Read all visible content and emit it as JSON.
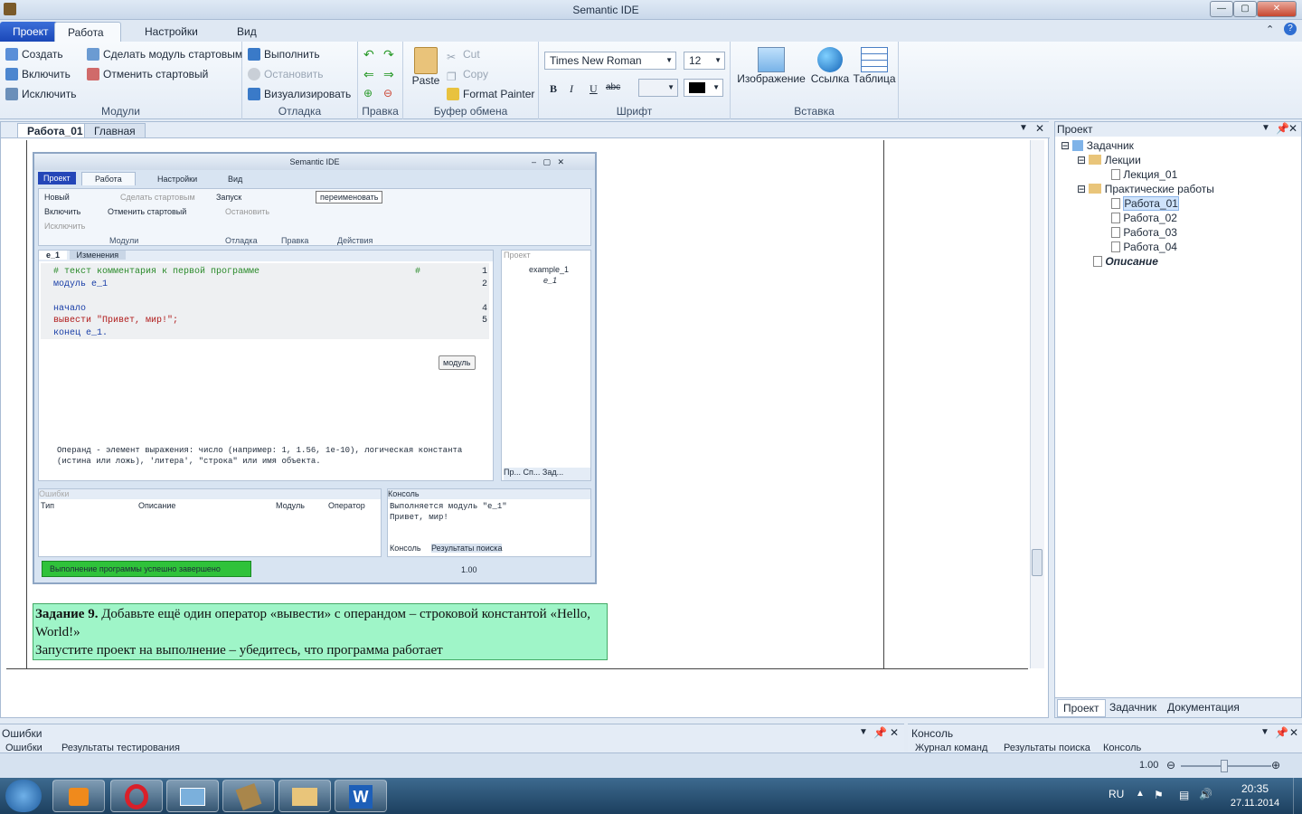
{
  "window": {
    "title": "Semantic IDE",
    "controls": [
      "minimize-icon",
      "maximize-icon",
      "close-icon"
    ]
  },
  "ribbon_tabs": [
    "Проект",
    "Работа",
    "Настройки",
    "Вид"
  ],
  "ribbon": {
    "modules": {
      "label": "Модули",
      "create": "Создать",
      "include": "Включить",
      "exclude": "Исключить",
      "make_start": "Сделать модуль стартовым",
      "cancel_start": "Отменить стартовый"
    },
    "debug": {
      "label": "Отладка",
      "run": "Выполнить",
      "stop": "Остановить",
      "visualize": "Визуализировать"
    },
    "edit": {
      "label": "Правка"
    },
    "clipboard": {
      "label": "Буфер обмена",
      "paste": "Paste",
      "cut": "Cut",
      "copy": "Copy",
      "format_painter": "Format Painter"
    },
    "font": {
      "label": "Шрифт",
      "family": "Times New Roman",
      "size": "12",
      "bold": "B",
      "italic": "I",
      "underline": "U",
      "strike": "abc"
    },
    "insert": {
      "label": "Вставка",
      "image": "Изображение",
      "link": "Ссылка",
      "table": "Таблица"
    }
  },
  "doc_tabs": [
    "Работа_01",
    "Главная"
  ],
  "inner": {
    "title": "Semantic IDE",
    "tabs": [
      "Проект",
      "Работа",
      "Настройки",
      "Вид"
    ],
    "modules": {
      "label": "Модули",
      "new": "Новый",
      "include": "Включить",
      "exclude": "Исключить",
      "make_start": "Сделать стартовым",
      "cancel_start": "Отменить стартовый"
    },
    "debug": {
      "label": "Отладка",
      "run": "Запуск",
      "stop": "Остановить"
    },
    "edit_label": "Правка",
    "actions": {
      "label": "Действия",
      "rename": "переименовать"
    },
    "editor_tabs": [
      "e_1",
      "Изменения"
    ],
    "code": [
      {
        "n": "1",
        "text": "# текст комментария к первой программе",
        "tail": "#"
      },
      {
        "n": "2",
        "text": "модуль e_1"
      },
      {
        "n": "",
        "text": ""
      },
      {
        "n": "4",
        "text": "начало"
      },
      {
        "n": "5",
        "text": "    вывести \"Привет, мир!\";"
      },
      {
        "n": "",
        "text": "конец e_1."
      }
    ],
    "tooltip": "модуль",
    "hint1": "Операнд - элемент выражения: число (например: 1, 1.56, 1e-10), логическая константа",
    "hint2": "(истина или  ложь), 'литера', \"строка\" или имя объекта.",
    "project": {
      "title": "Проект",
      "root": "example_1",
      "child": "e_1",
      "tabs": [
        "Пр...",
        "Сп...",
        "Зад..."
      ]
    },
    "errors": {
      "title": "Ошибки",
      "cols": [
        "Тип",
        "Описание",
        "Модуль",
        "Оператор"
      ]
    },
    "console": {
      "title": "Консоль",
      "lines": [
        "Выполняется модуль \"e_1\"",
        "Привет, мир!"
      ],
      "tabs": [
        "Консоль",
        "Результаты поиска"
      ]
    },
    "status": "Выполнение программы успешно завершено",
    "zoom": "1.00"
  },
  "task": {
    "bold": "Задание 9.",
    "line1": " Добавьте ещё один оператор «вывести» с операндом – строковой константой «Hello, World!»",
    "line2": "Запустите проект на выполнение – убедитесь, что программа работает"
  },
  "project_panel": {
    "title": "Проект",
    "tree": {
      "root": "Задачник",
      "lectures": "Лекции",
      "lecture1": "Лекция_01",
      "practice": "Практические работы",
      "works": [
        "Работа_01",
        "Работа_02",
        "Работа_03",
        "Работа_04"
      ],
      "desc": "Описание"
    },
    "tabs": [
      "Проект",
      "Задачник",
      "Документация"
    ]
  },
  "bottom": {
    "errors": "Ошибки",
    "errors_tabs": [
      "Ошибки",
      "Результаты тестирования"
    ],
    "console": "Консоль",
    "console_tabs": [
      "Журнал команд",
      "Результаты поиска",
      "Консоль"
    ],
    "zoom": "1.00"
  },
  "taskbar": {
    "lang": "RU",
    "time": "20:35",
    "date": "27.11.2014"
  }
}
